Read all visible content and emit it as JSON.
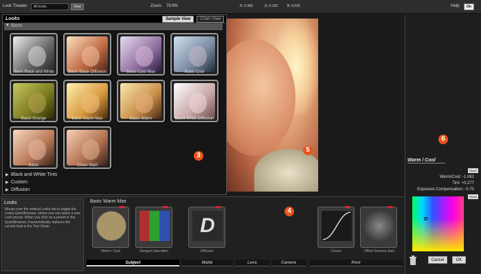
{
  "topbar": {
    "look_theater_label": "Look Theater:",
    "look_theater_value": "All looks",
    "view_button": "View",
    "zoom_label": "Zoom:",
    "zoom_value": "79.9%",
    "r_readout": "R: 0.383",
    "g_readout": "G: 0.163",
    "b_readout": "B: 0.025",
    "help_label": "Help:",
    "help_toggle": "On"
  },
  "looks_panel": {
    "title": "Looks",
    "tabs": [
      "Sample View",
      "Chain View"
    ],
    "open_category": "Basic",
    "thumbnails": [
      {
        "label": "Basic Black and White",
        "tint": "#bdbdbd"
      },
      {
        "label": "Basic Black Diffusion",
        "tint": "#d9a080"
      },
      {
        "label": "Basic Cool Max",
        "tint": "#b7a6c8"
      },
      {
        "label": "Basic Cool",
        "tint": "#a4b2c8"
      },
      {
        "label": "Basic Grunge",
        "tint": "#8a8a3a"
      },
      {
        "label": "Basic Warm Max",
        "tint": "#d7b06a"
      },
      {
        "label": "Basic Warm",
        "tint": "#c9955c"
      },
      {
        "label": "Basic White Diffusion",
        "tint": "#d8d4d6"
      },
      {
        "label": "Basic",
        "tint": "#c8a088"
      },
      {
        "label": "Clean Start",
        "tint": "#c49078"
      }
    ],
    "categories": [
      "Black and White Tints",
      "Custom",
      "Diffusion"
    ]
  },
  "markers": {
    "m3": "3",
    "m4": "4",
    "m5": "5",
    "m6": "6"
  },
  "right_panel": {
    "section_title": "Warm / Cool",
    "reset_label": "Reset",
    "params": [
      {
        "name": "Warm/Cool",
        "value": "-1.081"
      },
      {
        "name": "Tint",
        "value": "+0.277"
      },
      {
        "name": "Exposure Compensation",
        "value": "-0.70"
      }
    ],
    "cancel_button": "Cancel",
    "ok_button": "OK"
  },
  "bottom": {
    "help_title": "Looks",
    "help_text": "Mouse over the vertical Looks tab to toggle the Looks QuickBrowser, where you can select a new Look preset. When you click on a preset in the QuickBrowser, it automatically replaces the current look in the Tool Chain.",
    "look_name": "Basic Warm Max",
    "tools": [
      {
        "label": "Warm / Cool",
        "color": "#a89668"
      },
      {
        "label": "Ranged Saturation",
        "color": "#6a4a4a"
      },
      {
        "label": "Diffusion",
        "color": "#2a2a2a"
      },
      {
        "label": "Curves",
        "color": "#1a1a1a"
      },
      {
        "label": "Offset Gamma Gain",
        "color": "#1a1a1a"
      }
    ],
    "layers": [
      "Subject",
      "Matte",
      "Lens",
      "Camera",
      "Post"
    ]
  }
}
